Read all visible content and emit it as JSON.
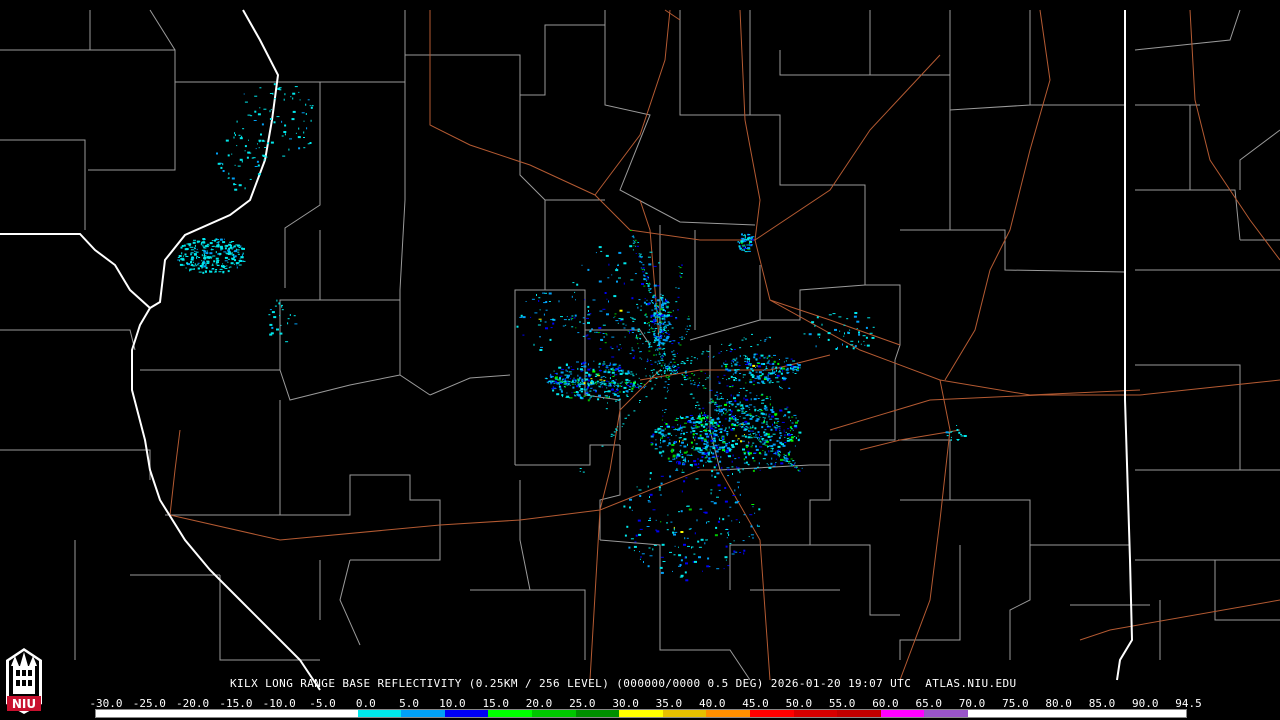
{
  "header": {
    "station": "KILX",
    "product": "LONG RANGE BASE REFLECTIVITY (0.25KM / 256 LEVEL)",
    "volume": "(000000/0000 0.5 DEG)",
    "timestamp": "2026-01-20 19:07 UTC",
    "source": "ATLAS.NIU.EDU"
  },
  "legend": {
    "labels": [
      "-30.0",
      "-25.0",
      "-20.0",
      "-15.0",
      "-10.0",
      "-5.0",
      "0.0",
      "5.0",
      "10.0",
      "15.0",
      "20.0",
      "25.0",
      "30.0",
      "35.0",
      "40.0",
      "45.0",
      "50.0",
      "55.0",
      "60.0",
      "65.0",
      "70.0",
      "75.0",
      "80.0",
      "85.0",
      "90.0",
      "94.5"
    ],
    "colors": [
      "#000000",
      "#000000",
      "#000000",
      "#000000",
      "#000000",
      "#000000",
      "#00e8ec",
      "#01a0f6",
      "#0000f6",
      "#00ff00",
      "#00c800",
      "#009000",
      "#ffff00",
      "#e7c000",
      "#ff9000",
      "#ff0000",
      "#d60000",
      "#c00000",
      "#ff00ff",
      "#9955c9",
      "#ffffff",
      "#ffffff",
      "#ffffff",
      "#ffffff",
      "#ffffff"
    ]
  },
  "logo": {
    "text": "NIU",
    "color": "#c8102e"
  },
  "colors": {
    "background": "#000000",
    "county_lines": "#9a9a9a",
    "state_lines": "#ffffff",
    "highways": "#b45a32"
  }
}
